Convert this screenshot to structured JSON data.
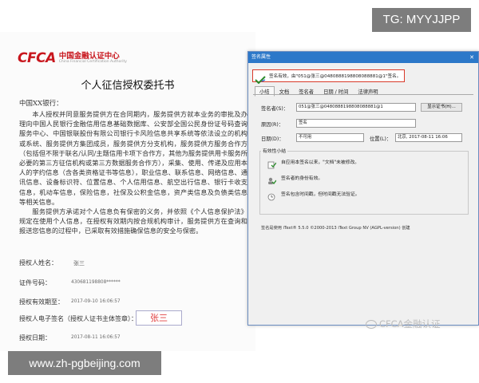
{
  "overlay": {
    "tag": "TG: MYYJJPP",
    "url": "www.zh-pgbeijing.com",
    "watermark": "CFCA金融认证"
  },
  "document": {
    "logo_mark": "CFCA",
    "logo_cn": "中国金融认证中心",
    "logo_en": "China Financial Certification Authority",
    "title": "个人征信授权委托书",
    "addressee": "中国XX银行：",
    "paragraphs": [
      "本人授权并同意服务提供方在合同期内，服务提供方就本业务的审批及办理向中国人民银行金融信用信息基础数据库、公安部全国公民身份证号码查询服务中心、中国银联股份有限公司银行卡风险信息共享系统等依法设立的机构或系统、服务提供方集团成员，服务提供方分支机构，服务提供方服务合作方（包括但不限于联名/认同/主题信用卡项下合作方，其他为服务提供用卡服务所必要的第三方征信机构或第三方数据服务合作方），采集、使用、传递及应用本人的字约信息（含各类资格证书等信息），职业信息、联系信息、网络信息、通讯信息、设备标识符、位置信息、个人信用信息、航空出行信息、银行卡收支信息，机动车信息，保险信息，社保及公积金信息，资产类信息及负债类信息等相关信息。",
      "服务提供方承诺对个人信息负有保密的义务，并依照《个人信息保护法》规定在使用个人信息，在授权有效期内按合规机构审计，服务提供方在查询和报送您信息的过程中，已采取有效措施确保信息的安全与保密。"
    ],
    "fields": {
      "name_label": "授权人姓名：",
      "name_value": "张三",
      "id_label": "证件号码：",
      "id_value": "430681198808******",
      "validity_label": "授权有效期至：",
      "validity_value": "2017-09-10 16:06:57",
      "signature_label": "授权人电子签名（授权人证书主体签章）：",
      "signature_value": "张三",
      "date_label": "授权日期：",
      "date_value": "2017-08-11 16:06:57"
    }
  },
  "dialog": {
    "title": "签名属性",
    "validity_banner": "签名有效，由\"051@张三@0480888198808088881@1\"签名。",
    "tabs": [
      "小结",
      "文档",
      "签名者",
      "日期 / 时间",
      "法律声明"
    ],
    "signer_label": "签名者(S)：",
    "signer_value": "051@张三@0480888198808088881@1",
    "show_cert_button": "显示证书(H)...",
    "reason_label": "原因(R)：",
    "reason_value": "签名",
    "date_label": "日期(D)：",
    "date_value": "不可用",
    "location_label": "位置(L)：",
    "location_value": "北京, 2017-08-11 16:06",
    "validity_group_title": "有效性小结",
    "status_lines": [
      "自应用本签名以来，\"文档\"未被修改。",
      "签名者的身份有效。",
      "签名包含时间戳，但时间戳无法验证。"
    ],
    "footer": "签名是使用 iText® 5.5.0 ©2000-2013 iText Group NV (AGPL-version) 创建"
  }
}
